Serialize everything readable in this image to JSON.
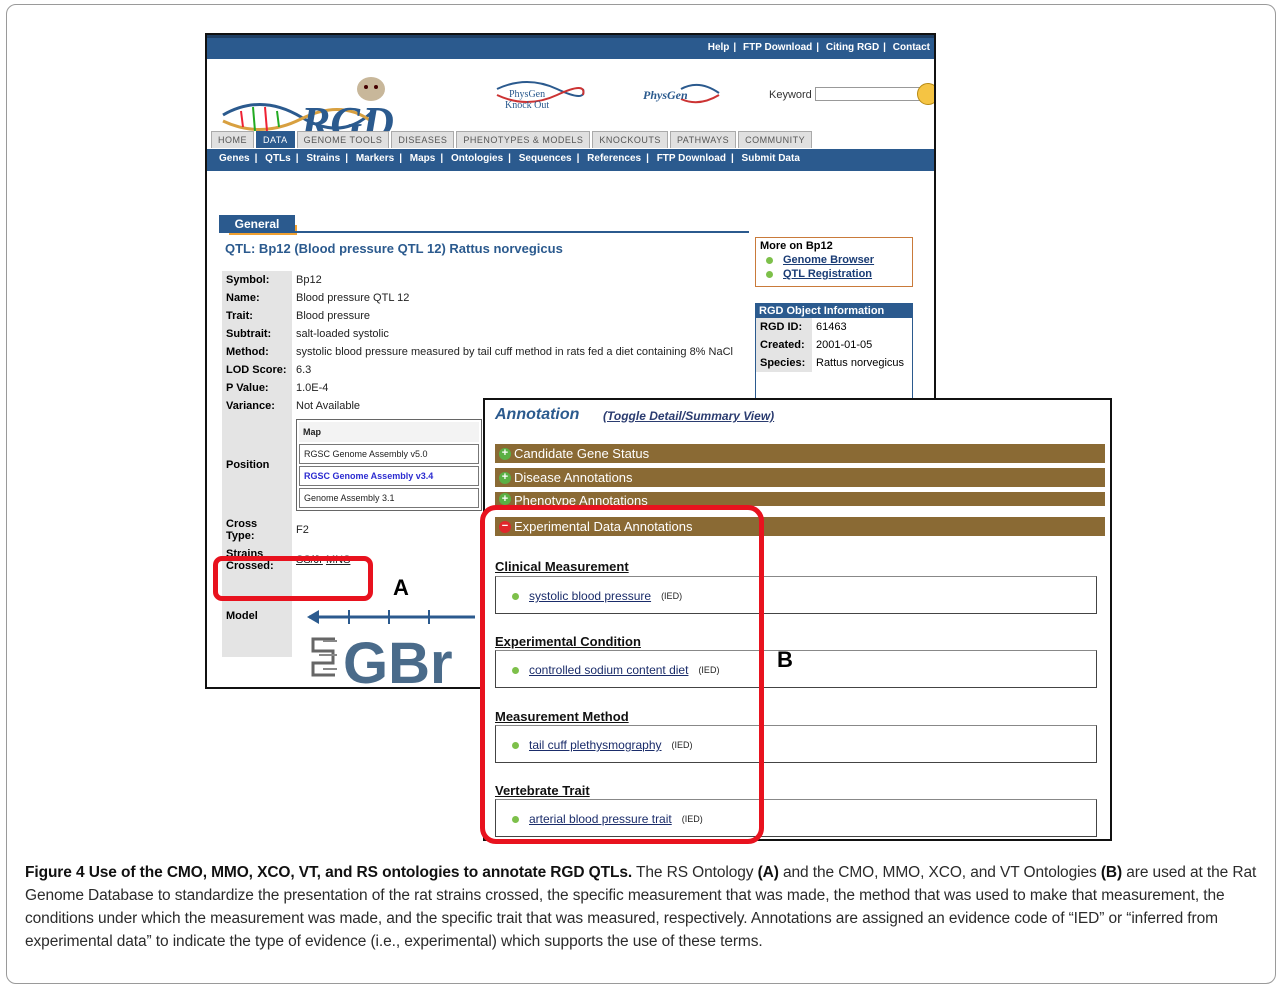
{
  "top_links": [
    "Help",
    "FTP Download",
    "Citing RGD",
    "Contact"
  ],
  "logo_text": "RGD",
  "physgen_ko_lines": [
    "PhysGen",
    "Knock Out"
  ],
  "physgen_label": "PhysGen",
  "keyword_label": "Keyword",
  "tabs": [
    "HOME",
    "DATA",
    "GENOME TOOLS",
    "DISEASES",
    "PHENOTYPES & MODELS",
    "KNOCKOUTS",
    "PATHWAYS",
    "COMMUNITY"
  ],
  "active_tab": "DATA",
  "subnav": [
    "Genes",
    "QTLs",
    "Strains",
    "Markers",
    "Maps",
    "Ontologies",
    "Sequences",
    "References",
    "FTP Download",
    "Submit Data"
  ],
  "general_label": "General",
  "qtl_title": "QTL: Bp12 (Blood pressure QTL 12) Rattus norvegicus",
  "props": {
    "symbol": {
      "k": "Symbol:",
      "v": "Bp12"
    },
    "name": {
      "k": "Name:",
      "v": "Blood pressure QTL 12"
    },
    "trait": {
      "k": "Trait:",
      "v": "Blood pressure"
    },
    "subtrait": {
      "k": "Subtrait:",
      "v": "salt-loaded systolic"
    },
    "method": {
      "k": "Method:",
      "v": "systolic blood pressure measured by tail cuff method in rats fed a diet containing 8% NaCl"
    },
    "lod": {
      "k": "LOD Score:",
      "v": "6.3"
    },
    "pvalue": {
      "k": "P Value:",
      "v": "1.0E-4"
    },
    "variance": {
      "k": "Variance:",
      "v": "Not Available"
    },
    "position": {
      "k": "Position",
      "map_header": "Map",
      "maps": [
        "RGSC Genome Assembly v5.0",
        "RGSC Genome Assembly v3.4",
        "Genome Assembly 3.1"
      ]
    },
    "cross_type": {
      "k": "Cross Type:",
      "v": "F2"
    },
    "strains": {
      "k1": "Strains",
      "k2": "Crossed:",
      "s1": "SS/Jr",
      "s2": "MNS"
    },
    "model": {
      "k": "Model"
    }
  },
  "gbrowse_text": "GBr",
  "more_on": {
    "title": "More on Bp12",
    "links": [
      "Genome Browser",
      "QTL Registration"
    ]
  },
  "obj_info": {
    "title": "RGD Object Information",
    "rows": [
      {
        "k": "RGD ID:",
        "v": "61463"
      },
      {
        "k": "Created:",
        "v": "2001-01-05"
      },
      {
        "k": "Species:",
        "v": "Rattus norvegicus"
      }
    ]
  },
  "annotation": {
    "title": "Annotation",
    "toggle": "(Toggle Detail/Summary View)",
    "bars": [
      "Candidate Gene Status",
      "Disease Annotations",
      "Phenotype Annotations",
      "Experimental Data Annotations"
    ],
    "sections": [
      {
        "title": "Clinical Measurement",
        "term": "systolic blood pressure",
        "ev": "(IED)"
      },
      {
        "title": "Experimental Condition",
        "term": "controlled sodium content diet",
        "ev": "(IED)"
      },
      {
        "title": "Measurement Method",
        "term": "tail cuff plethysmography",
        "ev": "(IED)"
      },
      {
        "title": "Vertebrate Trait",
        "term": "arterial blood pressure trait",
        "ev": "(IED)"
      }
    ]
  },
  "label_a": "A",
  "label_b": "B",
  "caption": {
    "fig": "Figure 4 Use of the CMO, MMO, XCO, VT, and RS ontologies to annotate RGD QTLs.",
    "t1": " The RS Ontology ",
    "a": "(A)",
    "t2": " and the CMO, MMO, XCO, and VT Ontologies ",
    "b": "(B)",
    "t3": " are used at the Rat Genome Database to standardize the presentation of the rat strains crossed, the specific measurement that was made, the method that was used to make that measurement, the conditions under which the measurement was made, and the specific trait that was measured, respectively. Annotations are assigned an evidence code of “IED” or “inferred from experimental data” to indicate the type of evidence (i.e., experimental) which supports the use of these terms."
  },
  "colors": {
    "nav_blue": "#2b5a8e",
    "annotation_bar": "#8a6a34",
    "highlight_red": "#e8121e"
  }
}
